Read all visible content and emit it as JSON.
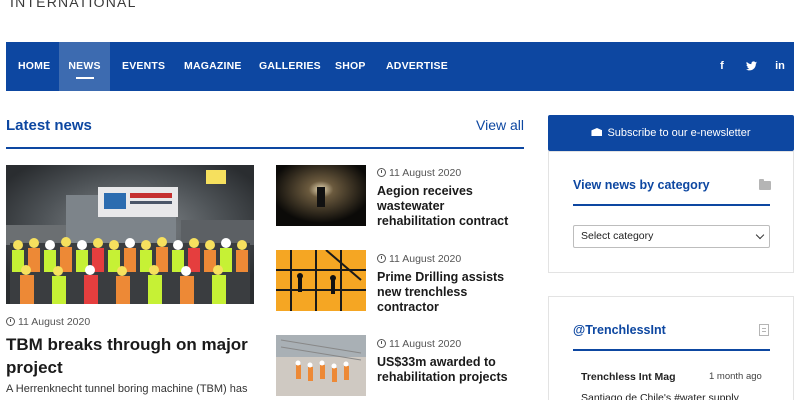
{
  "logo": {
    "text": "INTERNATIONAL"
  },
  "nav": {
    "items": [
      {
        "label": "HOME"
      },
      {
        "label": "NEWS",
        "active": true
      },
      {
        "label": "EVENTS"
      },
      {
        "label": "MAGAZINE"
      },
      {
        "label": "GALLERIES"
      },
      {
        "label": "SHOP"
      },
      {
        "label": "ADVERTISE"
      }
    ],
    "social": [
      "f",
      "t",
      "in"
    ],
    "social_icons": [
      "facebook-icon",
      "twitter-icon",
      "linkedin-icon"
    ]
  },
  "latest": {
    "title": "Latest news",
    "view_all": "View all",
    "main": {
      "date": "11 August 2020",
      "headline": "TBM breaks through on major project",
      "excerpt": "A Herrenknecht tunnel boring machine (TBM) has"
    },
    "side": [
      {
        "date": "11 August 2020",
        "headline": "Aegion receives wastewater rehabilitation contract"
      },
      {
        "date": "11 August 2020",
        "headline": "Prime Drilling assists new trenchless contractor"
      },
      {
        "date": "11 August 2020",
        "headline": "US$33m awarded to rehabilitation projects"
      }
    ]
  },
  "sidebar": {
    "subscribe_label": "Subscribe to our e-newsletter",
    "category": {
      "title": "View news by category",
      "select_value": "Select category"
    },
    "twitter": {
      "title": "@TrenchlessInt",
      "user": "Trenchless Int Mag",
      "time": "1 month ago",
      "text": "Santiago de Chile's #water supply"
    }
  },
  "colors": {
    "brand": "#0d47a1",
    "nav_active": "#3d6bb0"
  }
}
